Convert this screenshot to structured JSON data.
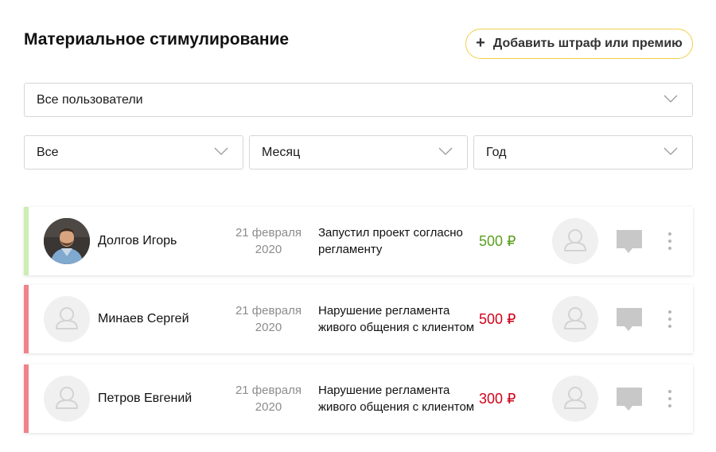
{
  "header": {
    "title": "Материальное стимулирование",
    "add_button": "Добавить штраф или премию"
  },
  "filters": {
    "users": "Все пользователи",
    "type": "Все",
    "month": "Месяц",
    "year": "Год"
  },
  "records": [
    {
      "name": "Долгов Игорь",
      "date_line1": "21 февраля",
      "date_line2": "2020",
      "description": "Запустил проект согласно регламенту",
      "amount": "500 ₽",
      "kind": "bonus",
      "has_photo": true
    },
    {
      "name": "Минаев Сергей",
      "date_line1": "21 февраля",
      "date_line2": "2020",
      "description": "Нарушение регламента живого общения с клиентом",
      "amount": "500 ₽",
      "kind": "penalty",
      "has_photo": false
    },
    {
      "name": "Петров Евгений",
      "date_line1": "21 февраля",
      "date_line2": "2020",
      "description": "Нарушение регламента живого общения с клиентом",
      "amount": "300 ₽",
      "kind": "penalty",
      "has_photo": false
    }
  ],
  "colors": {
    "bonus_stripe": "#cdeeb3",
    "bonus_amount": "#5a9e1e",
    "penalty_stripe": "#f0838c",
    "penalty_amount": "#d0021b",
    "button_border": "#f1cf4b"
  },
  "icons": {
    "add": "plus-icon",
    "dropdown": "chevron-down-icon",
    "placeholder_avatar": "user-icon",
    "comment": "comment-icon",
    "more": "more-vertical-icon"
  }
}
